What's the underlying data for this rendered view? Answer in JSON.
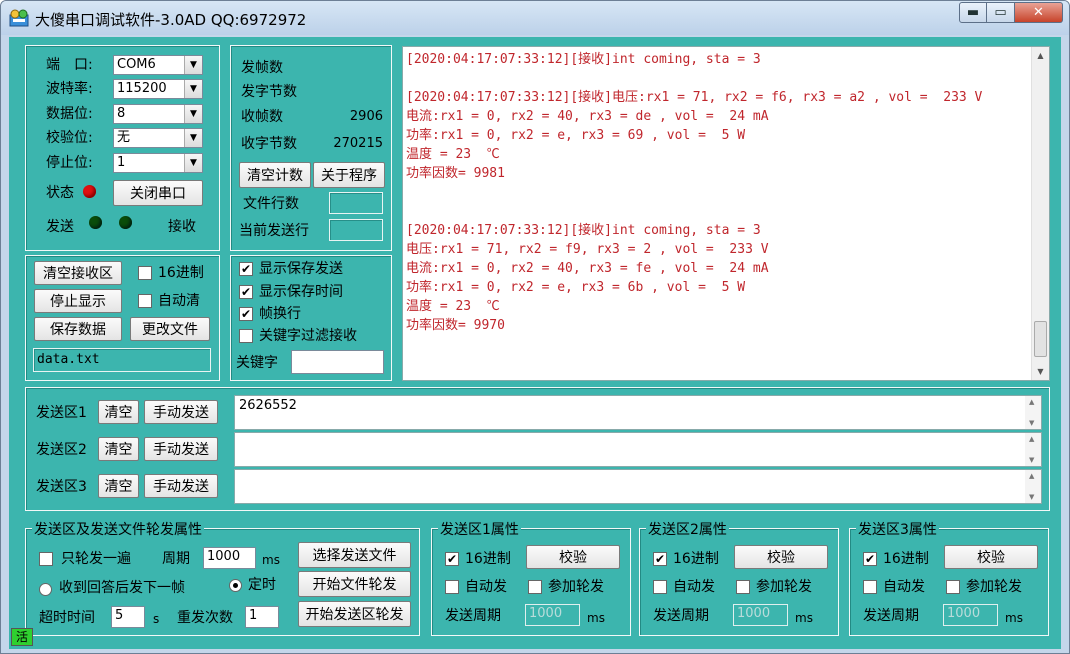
{
  "window": {
    "title": "大傻串口调试软件-3.0AD    QQ:6972972",
    "min_label": "▬",
    "max_label": "▭",
    "close_label": "✕"
  },
  "port": {
    "port_label": "端　口:",
    "port_value": "COM6",
    "baud_label": "波特率:",
    "baud_value": "115200",
    "databits_label": "数据位:",
    "databits_value": "8",
    "parity_label": "校验位:",
    "parity_value": "无",
    "stopbits_label": "停止位:",
    "stopbits_value": "1",
    "status_label": "状态",
    "close_port_label": "关闭串口",
    "send_label": "发送",
    "recv_label": "接收",
    "status_led_color": "#e01010",
    "send_led_color": "#0a4d0a",
    "recv_led_color": "#0a4d0a"
  },
  "counters": {
    "sent_frames_label": "发帧数",
    "sent_frames_value": "",
    "sent_bytes_label": "发字节数",
    "sent_bytes_value": "",
    "recv_frames_label": "收帧数",
    "recv_frames_value": "2906",
    "recv_bytes_label": "收字节数",
    "recv_bytes_value": "270215",
    "clear_count_label": "清空计数",
    "about_label": "关于程序",
    "file_lines_label": "文件行数",
    "file_lines_value": "",
    "current_line_label": "当前发送行",
    "current_line_value": ""
  },
  "recv_controls": {
    "clear_recv_label": "清空接收区",
    "hex_label": "16进制",
    "hex_checked": false,
    "stop_display_label": "停止显示",
    "auto_clear_label": "自动清",
    "auto_clear_checked": false,
    "save_data_label": "保存数据",
    "change_file_label": "更改文件",
    "file_name": "data.txt"
  },
  "display_options": {
    "show_save_send_label": "显示保存发送",
    "show_save_send_checked": true,
    "show_save_time_label": "显示保存时间",
    "show_save_time_checked": true,
    "frame_newline_label": "帧换行",
    "frame_newline_checked": true,
    "keyword_filter_label": "关键字过滤接收",
    "keyword_filter_checked": false,
    "keyword_label": "关键字",
    "keyword_value": ""
  },
  "receive_lines": [
    "[2020:04:17:07:33:12][接收]int coming, sta = 3",
    "",
    "[2020:04:17:07:33:12][接收]电压:rx1 = 71, rx2 = f6, rx3 = a2 , vol =  233 V",
    "电流:rx1 = 0, rx2 = 40, rx3 = de , vol =  24 mA",
    "功率:rx1 = 0, rx2 = e, rx3 = 69 , vol =  5 W",
    "温度 = 23  ℃",
    "功率因数= 9981",
    "",
    "",
    "[2020:04:17:07:33:12][接收]int coming, sta = 3",
    "电压:rx1 = 71, rx2 = f9, rx3 = 2 , vol =  233 V",
    "电流:rx1 = 0, rx2 = 40, rx3 = fe , vol =  24 mA",
    "功率:rx1 = 0, rx2 = e, rx3 = 6b , vol =  5 W",
    "温度 = 23  ℃",
    "功率因数= 9970"
  ],
  "send_areas": [
    {
      "label": "发送区1",
      "clear_label": "清空",
      "manual_send_label": "手动发送",
      "content": "2626552"
    },
    {
      "label": "发送区2",
      "clear_label": "清空",
      "manual_send_label": "手动发送",
      "content": ""
    },
    {
      "label": "发送区3",
      "clear_label": "清空",
      "manual_send_label": "手动发送",
      "content": ""
    }
  ],
  "rotation": {
    "group_title": "发送区及发送文件轮发属性",
    "only_once_label": "只轮发一遍",
    "only_once_checked": false,
    "period_label": "周期",
    "period_value": "1000",
    "period_unit": "ms",
    "reply_label": "收到回答后发下一帧",
    "timed_label": "定时",
    "timeout_label": "超时时间",
    "timeout_value": "5",
    "timeout_unit": "s",
    "retry_label": "重发次数",
    "retry_value": "1",
    "select_file_label": "选择发送文件",
    "start_file_label": "开始文件轮发",
    "start_area_label": "开始发送区轮发"
  },
  "area_props": [
    {
      "title": "发送区1属性",
      "hex_label": "16进制",
      "hex_checked": true,
      "check_label": "校验",
      "auto_send_label": "自动发",
      "join_label": "参加轮发",
      "period_label": "发送周期",
      "period_value": "1000",
      "unit": "ms"
    },
    {
      "title": "发送区2属性",
      "hex_label": "16进制",
      "hex_checked": true,
      "check_label": "校验",
      "auto_send_label": "自动发",
      "join_label": "参加轮发",
      "period_label": "发送周期",
      "period_value": "1000",
      "unit": "ms"
    },
    {
      "title": "发送区3属性",
      "hex_label": "16进制",
      "hex_checked": true,
      "check_label": "校验",
      "auto_send_label": "自动发",
      "join_label": "参加轮发",
      "period_label": "发送周期",
      "period_value": "1000",
      "unit": "ms"
    }
  ],
  "status": {
    "active_label": "活"
  },
  "icons": {
    "app": "app-icon",
    "dropdown": "chevron-down-icon"
  }
}
